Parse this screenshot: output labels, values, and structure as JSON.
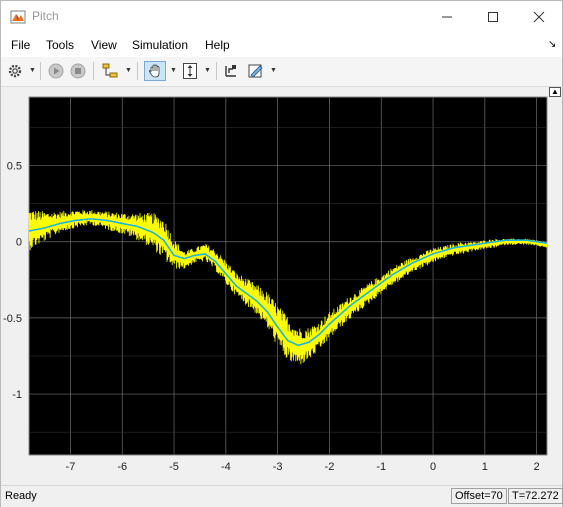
{
  "window": {
    "title": "Pitch"
  },
  "menu": {
    "items": [
      "File",
      "Tools",
      "View",
      "Simulation",
      "Help"
    ]
  },
  "toolbar": {
    "icons": [
      "settings-icon",
      "run-icon",
      "stop-icon",
      "signal-select-icon",
      "pan-icon",
      "zoom-y-icon",
      "axes-scale-icon",
      "style-icon"
    ]
  },
  "status": {
    "text": "Ready",
    "offset": "Offset=70",
    "time": "T=72.272"
  },
  "colors": {
    "raw_signal": "#ffff00",
    "filtered_signal": "#1fb5d8",
    "plot_background": "#000000",
    "grid": "#6e6e6e"
  },
  "chart_data": {
    "type": "line",
    "title": "",
    "xlabel": "",
    "ylabel": "",
    "xlim": [
      -7.8,
      2.2
    ],
    "ylim": [
      -1.4,
      0.95
    ],
    "grid": true,
    "x_ticks": [
      "-7",
      "-6",
      "-5",
      "-4",
      "-3",
      "-2",
      "-1",
      "0",
      "1",
      "2"
    ],
    "y_ticks": [
      "0.5",
      "0",
      "-0.5",
      "-1"
    ],
    "series": [
      {
        "role": "raw",
        "x": [
          -7.8,
          -7.5,
          -7.2,
          -6.9,
          -6.6,
          -6.3,
          -6.0,
          -5.7,
          -5.4,
          -5.2,
          -5.0,
          -4.8,
          -4.6,
          -4.4,
          -4.2,
          -4.0,
          -3.8,
          -3.6,
          -3.4,
          -3.2,
          -3.0,
          -2.8,
          -2.6,
          -2.4,
          -2.2,
          -2.0,
          -1.8,
          -1.6,
          -1.4,
          -1.2,
          -1.0,
          -0.8,
          -0.6,
          -0.4,
          -0.2,
          0.0,
          0.2,
          0.4,
          0.6,
          0.8,
          1.0,
          1.2,
          1.4,
          1.6,
          1.8,
          2.0,
          2.2
        ],
        "y": [
          0.08,
          0.1,
          0.13,
          0.15,
          0.16,
          0.14,
          0.12,
          0.1,
          0.07,
          0.02,
          -0.08,
          -0.12,
          -0.09,
          -0.07,
          -0.12,
          -0.2,
          -0.28,
          -0.33,
          -0.38,
          -0.45,
          -0.55,
          -0.64,
          -0.69,
          -0.67,
          -0.62,
          -0.55,
          -0.49,
          -0.43,
          -0.38,
          -0.33,
          -0.28,
          -0.23,
          -0.19,
          -0.15,
          -0.12,
          -0.09,
          -0.07,
          -0.05,
          -0.04,
          -0.03,
          -0.02,
          -0.01,
          0.0,
          0.0,
          0.0,
          -0.01,
          -0.02
        ],
        "noise": [
          0.14,
          0.1,
          0.07,
          0.06,
          0.05,
          0.06,
          0.07,
          0.09,
          0.12,
          0.14,
          0.1,
          0.06,
          0.05,
          0.06,
          0.07,
          0.08,
          0.08,
          0.09,
          0.1,
          0.12,
          0.14,
          0.15,
          0.13,
          0.11,
          0.1,
          0.09,
          0.08,
          0.08,
          0.07,
          0.07,
          0.06,
          0.06,
          0.06,
          0.05,
          0.05,
          0.05,
          0.04,
          0.04,
          0.04,
          0.03,
          0.03,
          0.03,
          0.02,
          0.02,
          0.02,
          0.02,
          0.02
        ]
      },
      {
        "role": "filtered",
        "x": [
          -7.8,
          -7.5,
          -7.2,
          -6.9,
          -6.6,
          -6.3,
          -6.0,
          -5.7,
          -5.4,
          -5.2,
          -5.0,
          -4.8,
          -4.6,
          -4.4,
          -4.2,
          -4.0,
          -3.8,
          -3.6,
          -3.4,
          -3.2,
          -3.0,
          -2.8,
          -2.6,
          -2.4,
          -2.2,
          -2.0,
          -1.8,
          -1.6,
          -1.4,
          -1.2,
          -1.0,
          -0.8,
          -0.6,
          -0.4,
          -0.2,
          0.0,
          0.2,
          0.4,
          0.6,
          0.8,
          1.0,
          1.2,
          1.4,
          1.6,
          1.8,
          2.0,
          2.2
        ],
        "y": [
          0.07,
          0.09,
          0.12,
          0.14,
          0.15,
          0.14,
          0.12,
          0.1,
          0.06,
          0.01,
          -0.09,
          -0.11,
          -0.09,
          -0.08,
          -0.13,
          -0.21,
          -0.29,
          -0.34,
          -0.39,
          -0.46,
          -0.56,
          -0.65,
          -0.68,
          -0.66,
          -0.61,
          -0.54,
          -0.48,
          -0.42,
          -0.37,
          -0.32,
          -0.27,
          -0.22,
          -0.18,
          -0.14,
          -0.11,
          -0.08,
          -0.06,
          -0.04,
          -0.03,
          -0.02,
          -0.01,
          0.0,
          0.01,
          0.01,
          0.01,
          0.0,
          -0.01
        ]
      }
    ]
  }
}
